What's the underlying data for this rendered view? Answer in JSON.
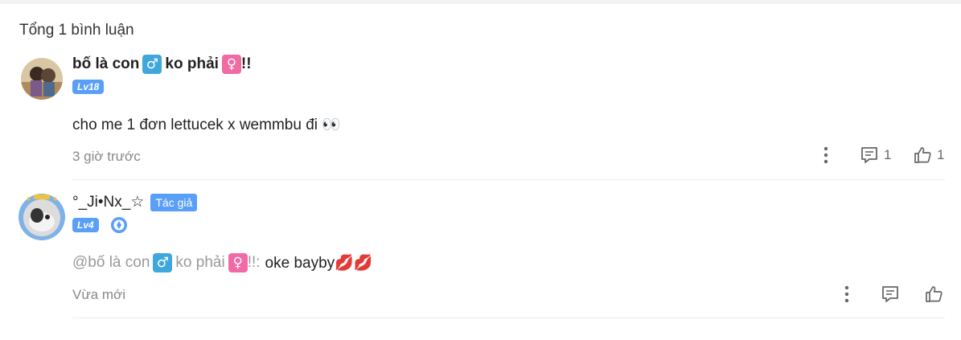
{
  "comments_header": {
    "total_label": "Tổng 1 bình luận"
  },
  "comments": [
    {
      "user": {
        "name_part1": "bố là con",
        "male_symbol": "♂",
        "name_part2": "ko phải",
        "female_symbol": "♀",
        "name_suffix": "!!",
        "level": "Lv18"
      },
      "text": "cho me 1 đơn lettucek x wemmbu đi 👀",
      "time": "3 giờ trước",
      "reply_count": "1",
      "like_count": "1",
      "icons": [
        "more-icon",
        "reply-icon",
        "like-icon"
      ]
    },
    {
      "user": {
        "name": "°_Ji•Nx_☆",
        "author_tag": "Tác giả",
        "level": "Lv4"
      },
      "mention": {
        "prefix": "@bố là con",
        "male_symbol": "♂",
        "mid": "ko phải",
        "female_symbol": "♀",
        "suffix": "!!:"
      },
      "text": "oke bayby💋💋",
      "time": "Vừa mới",
      "icons": [
        "more-icon",
        "reply-icon",
        "like-icon"
      ]
    }
  ],
  "colors": {
    "accent": "#5a9ff7",
    "male": "#3fa7dc",
    "female": "#f06aa5",
    "muted": "#888888"
  }
}
